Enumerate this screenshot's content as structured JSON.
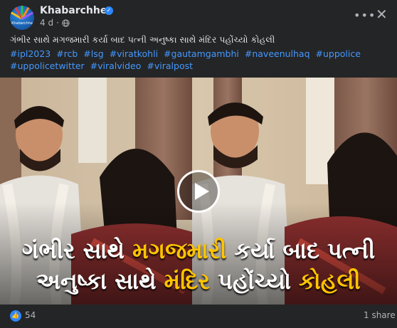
{
  "post": {
    "page_name": "Khabarchhe",
    "avatar_text": "Khabarchhe",
    "time": "4 d",
    "caption": "ગંભીર સાથે મગજમારી કર્યા બાદ પત્ની અનુષ્કા સાથે મંદિર પહોંચ્યો કોહલી",
    "hashtags": [
      "#ipl2023",
      "#rcb",
      "#lsg",
      "#viratkohli",
      "#gautamgambhi",
      "#naveenulhaq",
      "#uppolice",
      "#uppolicetwitter",
      "#viralvideo",
      "#viralpost"
    ]
  },
  "video": {
    "overlay_line1": [
      "ગંભીર સાથે ",
      "મગજમારી",
      " કર્યા બાદ પત્ની"
    ],
    "overlay_line2": [
      "અનુષ્કા સાથે ",
      "મંદિર",
      " પહોંચ્યો ",
      "કોહલી"
    ]
  },
  "footer": {
    "like_count": "54",
    "shares": "1 share"
  },
  "icons": {
    "verified": "verified-badge-icon",
    "globe": "globe-icon",
    "more": "more-options-icon",
    "close": "close-icon",
    "play": "play-icon",
    "like": "like-reaction-icon"
  },
  "colors": {
    "background": "#242526",
    "hashtag": "#4599ff",
    "overlay_highlight": "#ffc400",
    "overlay_text": "#ffffff",
    "accent": "#2d88ff"
  }
}
